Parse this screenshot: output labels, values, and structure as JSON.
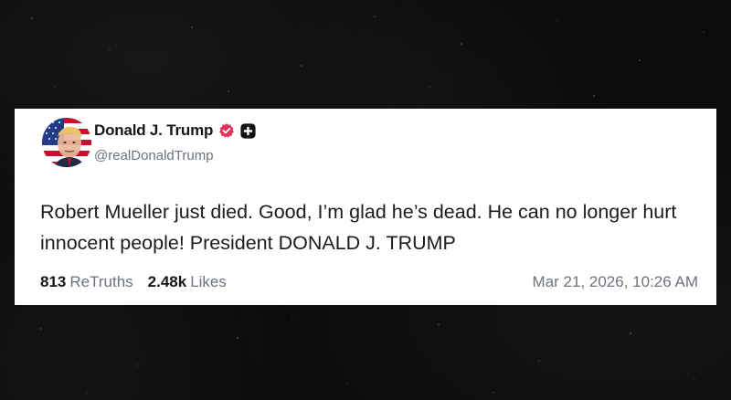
{
  "post": {
    "author": {
      "display_name": "Donald J. Trump",
      "handle": "@realDonaldTrump",
      "verified_badge_color": "#e0355c",
      "avatar_icon": "flag-portrait-avatar"
    },
    "text": "Robert Mueller just died. Good, I’m glad he’s dead. He can no longer hurt innocent people! President DONALD J. TRUMP",
    "stats": {
      "retruths_count": "813",
      "retruths_label": "ReTruths",
      "likes_count": "2.48k",
      "likes_label": "Likes"
    },
    "timestamp": "Mar 21, 2026, 10:26 AM"
  },
  "colors": {
    "background": "#0b0b0b",
    "card": "#ffffff",
    "text_primary": "#14171a",
    "text_secondary": "#6b7280"
  }
}
